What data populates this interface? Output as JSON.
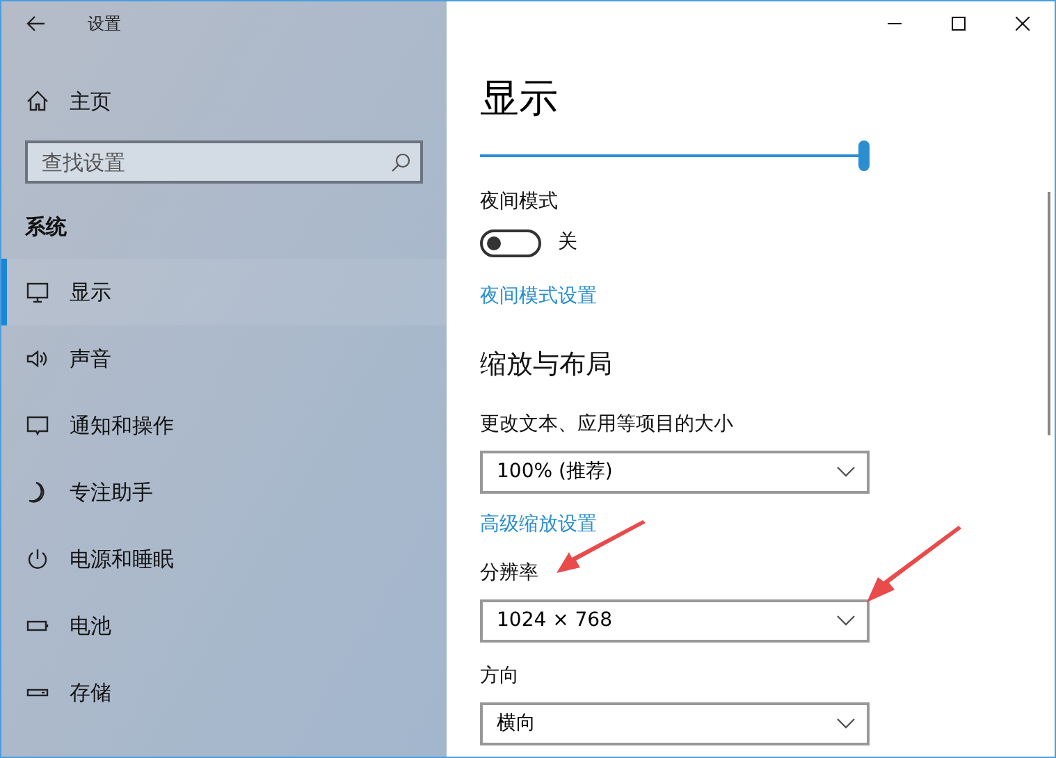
{
  "window": {
    "title": "设置"
  },
  "sidebar": {
    "home": "主页",
    "search": {
      "placeholder": "查找设置"
    },
    "section": "系统",
    "items": [
      {
        "label": "显示",
        "selected": true
      },
      {
        "label": "声音",
        "selected": false
      },
      {
        "label": "通知和操作",
        "selected": false
      },
      {
        "label": "专注助手",
        "selected": false
      },
      {
        "label": "电源和睡眠",
        "selected": false
      },
      {
        "label": "电池",
        "selected": false
      },
      {
        "label": "存储",
        "selected": false
      }
    ]
  },
  "content": {
    "title": "显示",
    "slider": {
      "level": 1
    },
    "night_mode": {
      "label": "夜间模式",
      "toggle": {
        "on": false,
        "state_text": "关"
      },
      "link": "夜间模式设置"
    },
    "scale_heading": "缩放与布局",
    "settings": [
      {
        "label": "更改文本、应用等项目的大小",
        "value": "100% (推荐)",
        "link": "高级缩放设置"
      },
      {
        "label": "分辨率",
        "value": "1024 × 768"
      },
      {
        "label": "方向",
        "value": "横向"
      }
    ]
  }
}
